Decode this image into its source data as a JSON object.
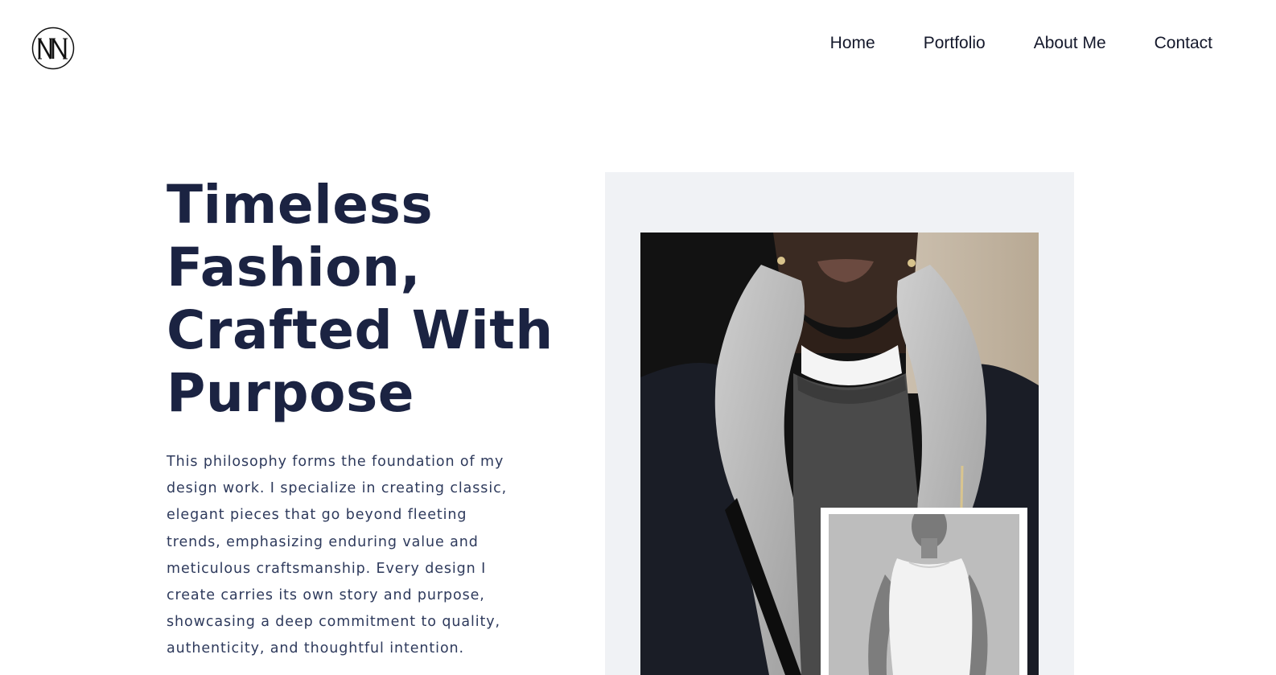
{
  "header": {
    "logo_text": "NN",
    "nav": [
      {
        "label": "Home"
      },
      {
        "label": "Portfolio"
      },
      {
        "label": "About Me"
      },
      {
        "label": "Contact"
      }
    ]
  },
  "hero": {
    "title_lines": [
      "Timeless",
      "Fashion,",
      "Crafted With",
      "Purpose"
    ],
    "description": "This philosophy forms the foundation of my design work. I specialize in creating classic, elegant pieces that go beyond fleeting trends, emphasizing enduring value and meticulous craftsmanship. Every design I create carries its own story and purpose, showcasing a deep commitment to quality, authenticity, and thoughtful intention."
  },
  "colors": {
    "heading": "#1b2342",
    "body_text": "#2e3a5c",
    "panel_bg": "#f0f2f5"
  }
}
